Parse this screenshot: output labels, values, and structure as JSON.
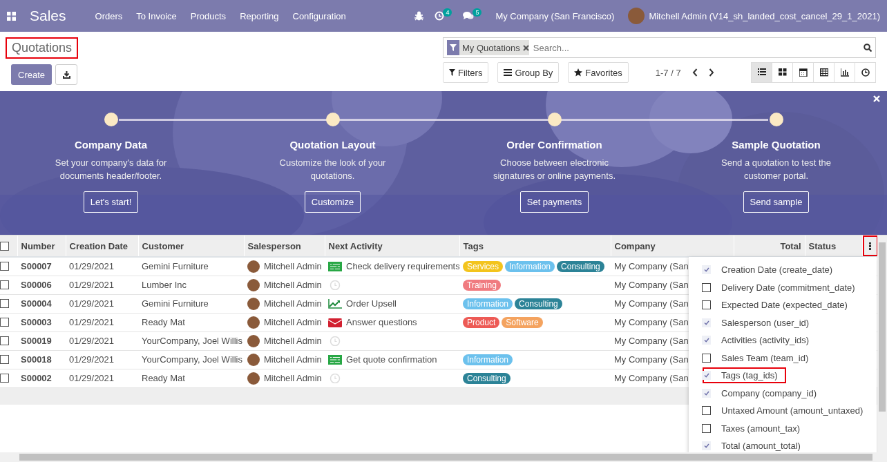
{
  "navbar": {
    "app": "Sales",
    "menu": [
      "Orders",
      "To Invoice",
      "Products",
      "Reporting",
      "Configuration"
    ],
    "activity_count": "4",
    "message_count": "5",
    "company": "My Company (San Francisco)",
    "user": "Mitchell Admin (V14_sh_landed_cost_cancel_29_1_2021)"
  },
  "control_panel": {
    "title": {
      "text": "Quotations",
      "highlighted": true
    },
    "create": "Create",
    "facet": "My Quotations",
    "search_placeholder": "Search...",
    "filters": "Filters",
    "group_by": "Group By",
    "favorites": "Favorites",
    "pager": "1-7 / 7",
    "views": [
      {
        "kind": "list",
        "selected": true
      },
      {
        "kind": "kanban",
        "selected": false
      },
      {
        "kind": "calendar",
        "selected": false
      },
      {
        "kind": "pivot",
        "selected": false
      },
      {
        "kind": "graph",
        "selected": false
      },
      {
        "kind": "activity",
        "selected": false
      }
    ]
  },
  "onboarding": {
    "steps": [
      {
        "title": "Company Data",
        "description": "Set your company's data for documents header/footer.",
        "button": "Let's start!"
      },
      {
        "title": "Quotation Layout",
        "description": "Customize the look of your quotations.",
        "button": "Customize"
      },
      {
        "title": "Order Confirmation",
        "description": "Choose between electronic signatures or online payments.",
        "button": "Set payments"
      },
      {
        "title": "Sample Quotation",
        "description": "Send a quotation to test the customer portal.",
        "button": "Send sample"
      }
    ]
  },
  "table": {
    "columns": [
      "Number",
      "Creation Date",
      "Customer",
      "Salesperson",
      "Next Activity",
      "Tags",
      "Company",
      "Total",
      "Status"
    ],
    "menu_highlighted": true,
    "select_all_checked": false,
    "rows": [
      {
        "checked": false,
        "number": "S00007",
        "date": "01/29/2021",
        "customer": "Gemini Furniture",
        "salesperson": "Mitchell Admin",
        "activity": {
          "kind": "todo",
          "text": "Check delivery requirements"
        },
        "tags": [
          {
            "text": "Services",
            "color": "#f3c41d"
          },
          {
            "text": "Information",
            "color": "#6cc1ed"
          },
          {
            "text": "Consulting",
            "color": "#2c8397"
          }
        ],
        "company": "My Company (San"
      },
      {
        "checked": false,
        "number": "S00006",
        "date": "01/29/2021",
        "customer": "Lumber Inc",
        "salesperson": "Mitchell Admin",
        "activity": {
          "kind": "none"
        },
        "tags": [
          {
            "text": "Training",
            "color": "#f07b80"
          }
        ],
        "company": "My Company (San"
      },
      {
        "checked": false,
        "number": "S00004",
        "date": "01/29/2021",
        "customer": "Gemini Furniture",
        "salesperson": "Mitchell Admin",
        "activity": {
          "kind": "upsell",
          "text": "Order Upsell"
        },
        "tags": [
          {
            "text": "Information",
            "color": "#6cc1ed"
          },
          {
            "text": "Consulting",
            "color": "#2c8397"
          }
        ],
        "company": "My Company (San"
      },
      {
        "checked": false,
        "number": "S00003",
        "date": "01/29/2021",
        "customer": "Ready Mat",
        "salesperson": "Mitchell Admin",
        "activity": {
          "kind": "email",
          "text": "Answer questions"
        },
        "tags": [
          {
            "text": "Product",
            "color": "#ed5a55"
          },
          {
            "text": "Software",
            "color": "#f4a35f"
          }
        ],
        "company": "My Company (San"
      },
      {
        "checked": false,
        "number": "S00019",
        "date": "01/29/2021",
        "customer": "YourCompany, Joel Willis",
        "salesperson": "Mitchell Admin",
        "activity": {
          "kind": "none"
        },
        "company": "My Company (San"
      },
      {
        "checked": false,
        "number": "S00018",
        "date": "01/29/2021",
        "customer": "YourCompany, Joel Willis",
        "salesperson": "Mitchell Admin",
        "activity": {
          "kind": "todo",
          "text": "Get quote confirmation"
        },
        "tags": [
          {
            "text": "Information",
            "color": "#6cc1ed"
          }
        ],
        "company": "My Company (San"
      },
      {
        "checked": false,
        "number": "S00002",
        "date": "01/29/2021",
        "customer": "Ready Mat",
        "salesperson": "Mitchell Admin",
        "activity": {
          "kind": "none"
        },
        "tags": [
          {
            "text": "Consulting",
            "color": "#2c8397"
          }
        ],
        "company": "My Company (San"
      }
    ]
  },
  "column_menu": {
    "items": [
      {
        "label": "Creation Date (create_date)",
        "checked": true,
        "highlighted": false
      },
      {
        "label": "Delivery Date (commitment_date)",
        "checked": false,
        "highlighted": false
      },
      {
        "label": "Expected Date (expected_date)",
        "checked": false,
        "highlighted": false
      },
      {
        "label": "Salesperson (user_id)",
        "checked": true,
        "highlighted": false
      },
      {
        "label": "Activities (activity_ids)",
        "checked": true,
        "highlighted": false
      },
      {
        "label": "Sales Team (team_id)",
        "checked": false,
        "highlighted": false
      },
      {
        "label": "Tags (tag_ids)",
        "checked": true,
        "highlighted": true
      },
      {
        "label": "Company (company_id)",
        "checked": true,
        "highlighted": false
      },
      {
        "label": "Untaxed Amount (amount_untaxed)",
        "checked": false,
        "highlighted": false
      },
      {
        "label": "Taxes (amount_tax)",
        "checked": false,
        "highlighted": false
      },
      {
        "label": "Total (amount_total)",
        "checked": true,
        "highlighted": false
      }
    ]
  }
}
